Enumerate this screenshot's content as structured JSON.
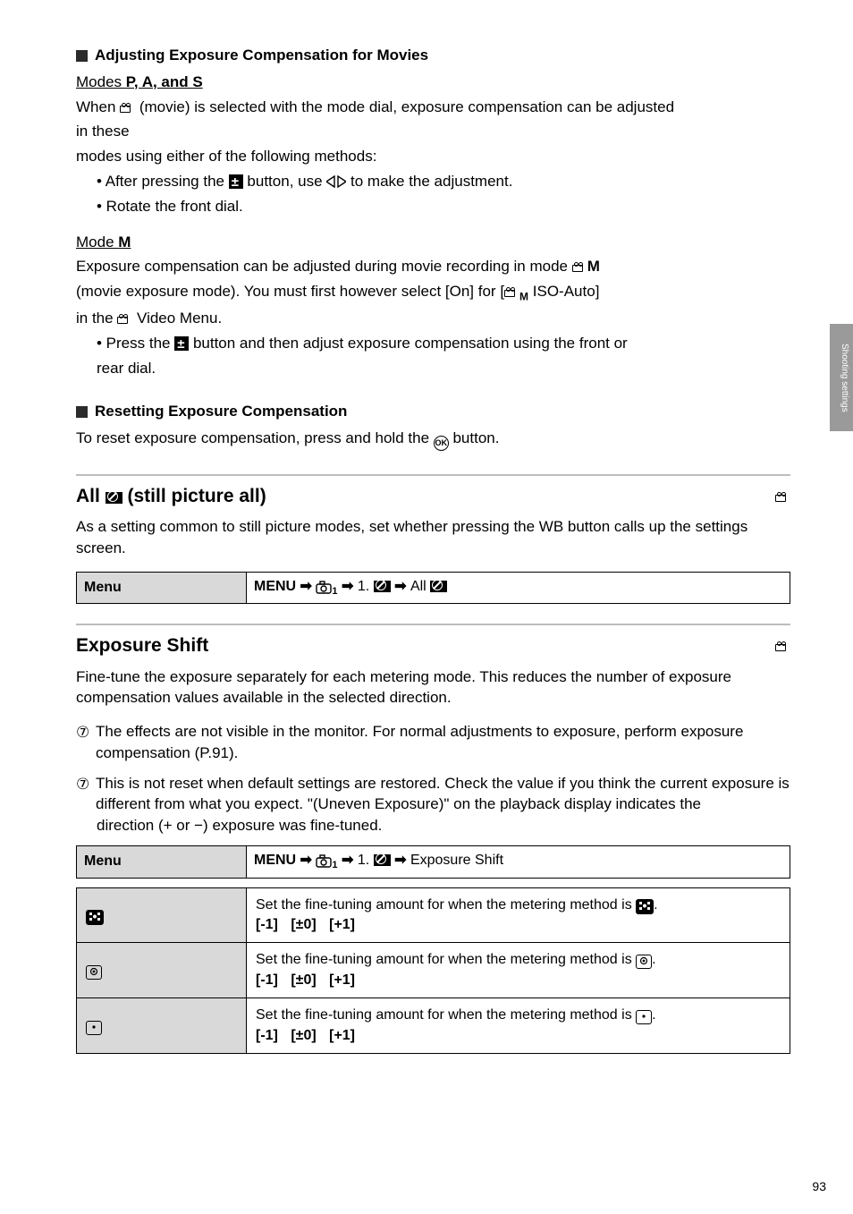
{
  "section1": {
    "heading": "Adjusting Exposure Compensation for Movies",
    "modeLabel": "Modes ",
    "modes": "P, A, and S",
    "line1_a": "When ",
    "line1_b": " (movie) is selected with the mode dial, exposure compensation can be adjusted",
    "line2": "in these",
    "line3": "modes using either of the following methods:",
    "bullet1_a": "• After pressing the ",
    "bullet1_b": " button, use ",
    "bullet1_c": " to make the adjustment.",
    "bullet2_a": "• Rotate the front dial.",
    "modeLabel2": "Mode ",
    "modes2": "M",
    "m_line1_a": "Exposure compensation can be adjusted during movie recording in mode ",
    "m_line2_a": "(movie exposure mode). You must first however select [On] for [",
    "m_line2_sub": "M",
    "m_line2_b": " ISO-Auto]",
    "m_line3": "in the ",
    "m_line3b": " Video Menu.",
    "m_bullet1_a": "• Press the ",
    "m_bullet1_b": " button and then adjust exposure compensation using the front or"
  },
  "section2": {
    "heading": "Resetting Exposure Compensation",
    "line1_a": "To reset exposure compensation, press and hold the ",
    "line1_b": " button."
  },
  "feature1": {
    "title": "All ",
    "title2": " (still picture all)",
    "desc": "As a setting common to still picture modes, set whether pressing the WB button calls up the settings screen.",
    "menu_label": "Menu",
    "menu_path_a": " 1. ",
    "menu_path_b": " All"
  },
  "feature2": {
    "title": "Exposure Shift",
    "desc": "Fine-tune the exposure separately for each metering mode. This reduces the number of exposure compensation values available in the selected direction.",
    "note1": "The effects are not visible in the monitor. For normal adjustments to exposure, perform exposure compensation (P.91).",
    "note2_a": "This is not reset when default settings are restored. Check the value if you think the current exposure is different from what you expect. \"(Uneven Exposure)\" on the playback display indicates the",
    "note2_b": "direction (+ or −) exposure was fine-tuned.",
    "menu_label": "Menu",
    "menu_path_a": " 1. ",
    "menu_path_b": " Exposure Shift"
  },
  "options": {
    "r1_a": "Set the fine-tuning amount for when the metering method is ",
    "r1_b": ".",
    "r2_a": "Set the fine-tuning amount for when the metering method is ",
    "r2_b": ".",
    "r3_a": "Set the fine-tuning amount for when the metering method is ",
    "r3_b": ".",
    "values": "[-1] [±0] [+1]"
  },
  "sidebar": "Shooting settings",
  "page": "93"
}
